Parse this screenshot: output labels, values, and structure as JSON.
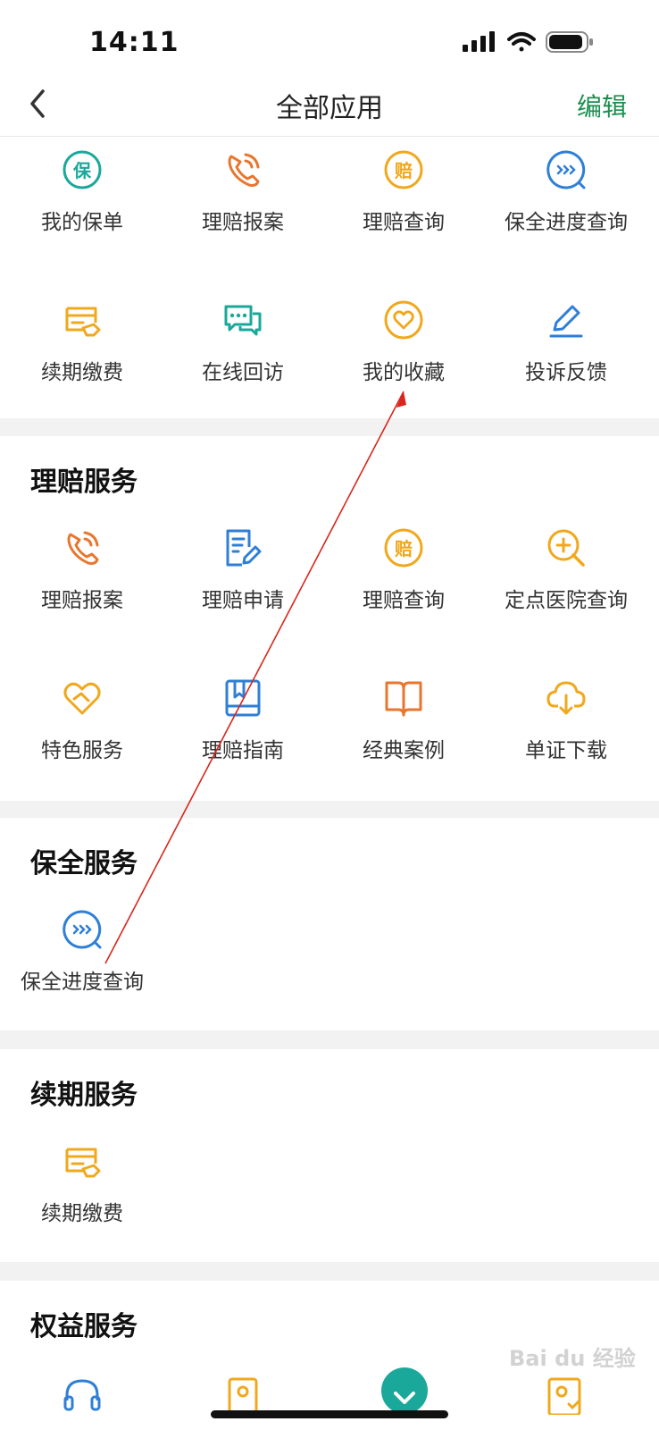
{
  "status": {
    "time": "14:11"
  },
  "header": {
    "title": "全部应用",
    "edit": "编辑"
  },
  "my_apps": [
    {
      "label": "我的保单",
      "icon": "policy-icon"
    },
    {
      "label": "理赔报案",
      "icon": "phone-icon"
    },
    {
      "label": "理赔查询",
      "icon": "compensation-icon"
    },
    {
      "label": "保全进度查询",
      "icon": "chat-progress-icon"
    },
    {
      "label": "续期缴费",
      "icon": "payment-icon"
    },
    {
      "label": "在线回访",
      "icon": "chat-bubbles-icon"
    },
    {
      "label": "我的收藏",
      "icon": "heart-icon"
    },
    {
      "label": "投诉反馈",
      "icon": "pencil-icon"
    }
  ],
  "claims": {
    "title": "理赔服务",
    "items": [
      {
        "label": "理赔报案",
        "icon": "phone-icon"
      },
      {
        "label": "理赔申请",
        "icon": "form-edit-icon"
      },
      {
        "label": "理赔查询",
        "icon": "compensation-icon"
      },
      {
        "label": "定点医院查询",
        "icon": "search-plus-icon"
      },
      {
        "label": "特色服务",
        "icon": "heart-hand-icon"
      },
      {
        "label": "理赔指南",
        "icon": "guide-book-icon"
      },
      {
        "label": "经典案例",
        "icon": "open-book-icon"
      },
      {
        "label": "单证下载",
        "icon": "cloud-download-icon"
      }
    ]
  },
  "preservation": {
    "title": "保全服务",
    "items": [
      {
        "label": "保全进度查询",
        "icon": "chat-progress-icon"
      }
    ]
  },
  "renewal": {
    "title": "续期服务",
    "items": [
      {
        "label": "续期缴费",
        "icon": "payment-icon"
      }
    ]
  },
  "rights": {
    "title": "权益服务"
  },
  "colors": {
    "accent": "#1a8f4f",
    "teal": "#1aa89a",
    "orange": "#e8762e",
    "gold": "#f0a81c",
    "blue": "#2f7fd6"
  }
}
